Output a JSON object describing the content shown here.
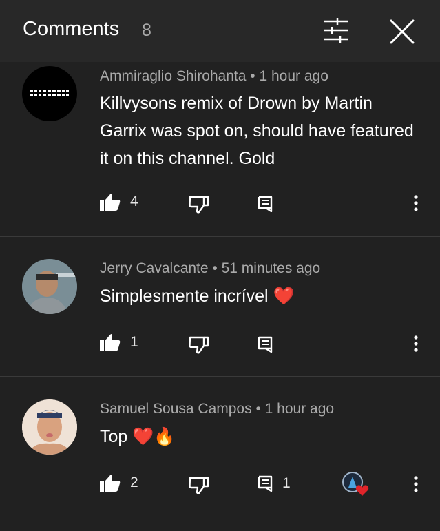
{
  "header": {
    "title": "Comments",
    "count": "8"
  },
  "comments": [
    {
      "author": "Ammiraglio Shirohanta",
      "time": "1 hour ago",
      "text": "Killvysons remix of Drown by Martin Garrix was spot on, should have featured it on this channel. Gold",
      "likes": "4",
      "replies": ""
    },
    {
      "author": "Jerry Cavalcante",
      "time": "51 minutes ago",
      "text": "Simplesmente incrível",
      "emoji": "❤️",
      "likes": "1",
      "replies": ""
    },
    {
      "author": "Samuel Sousa Campos",
      "time": "1 hour ago",
      "text": "Top",
      "emoji": "❤️🔥",
      "likes": "2",
      "replies": "1"
    }
  ],
  "separator": "•",
  "colors": {
    "background": "#212121",
    "header": "#282828",
    "meta": "#aaaaaa",
    "heart": "#e0242a"
  }
}
